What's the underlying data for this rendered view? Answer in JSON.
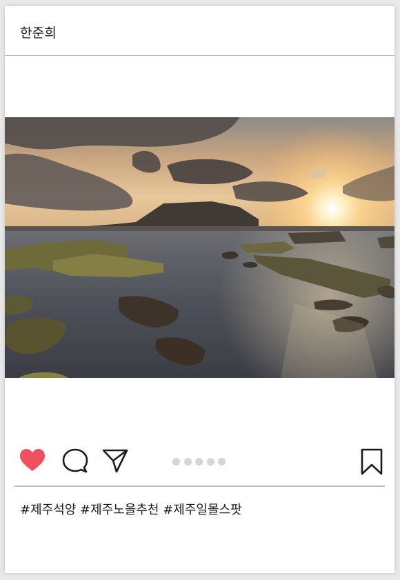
{
  "post": {
    "username": "한준희",
    "hashtags": "#제주석양 #제주노을추천 #제주일몰스팟",
    "liked": true,
    "carousel_dot_count": 5
  },
  "colors": {
    "like_color": "#f0505e",
    "icon_color": "#1b1b1b",
    "dot_color": "#d6d6d6"
  },
  "icons": {
    "like": "heart-icon",
    "comment": "comment-icon",
    "share": "send-icon",
    "save": "bookmark-icon"
  }
}
